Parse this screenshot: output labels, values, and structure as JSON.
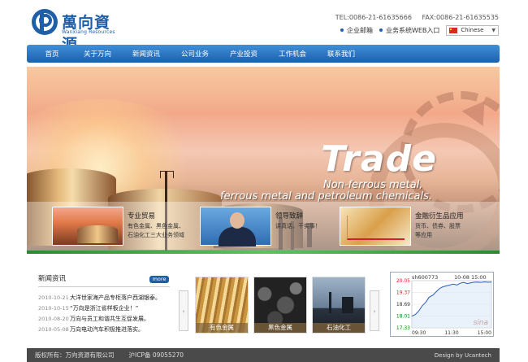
{
  "logo": {
    "cn": "萬向資源",
    "en": "Wanxiang Resources"
  },
  "contact": {
    "tel": "TEL:0086-21-61635666",
    "fax": "FAX:0086-21-61635535"
  },
  "quicklinks": [
    {
      "label": "企业邮箱"
    },
    {
      "label": "业务系统WEB入口"
    }
  ],
  "language": {
    "selected": "Chinese"
  },
  "nav": [
    {
      "label": "首页"
    },
    {
      "label": "关于万向"
    },
    {
      "label": "新闻资讯"
    },
    {
      "label": "公司业务"
    },
    {
      "label": "产业投资"
    },
    {
      "label": "工作机会"
    },
    {
      "label": "联系我们"
    }
  ],
  "banner": {
    "headline": "Trade",
    "line1": "Non-ferrous metal,",
    "line2": "ferrous metal and petroleum chemicals."
  },
  "features": [
    {
      "title": "专业贸易",
      "desc1": "有色金属、黑色金属、",
      "desc2": "石油化工三大业务领域"
    },
    {
      "title": "领导致辞",
      "desc1": "讲真话，干实事！",
      "desc2": ""
    },
    {
      "title": "金融衍生品应用",
      "desc1": "货币、债券、股票",
      "desc2": "等应用"
    }
  ],
  "news": {
    "heading": "新闻资讯",
    "more": "more",
    "items": [
      {
        "date": "2010-10-21",
        "title": "大洋世家海产品专柜落户西湖银泰。"
      },
      {
        "date": "2010-10-15",
        "title": "“万向是浙江省样板企业！”"
      },
      {
        "date": "2010-08-20",
        "title": "万向与员工和谐共生互促发展。"
      },
      {
        "date": "2010-05-08",
        "title": "万向电动汽车积极推进落实。"
      }
    ]
  },
  "products": [
    {
      "label": "有色金属"
    },
    {
      "label": "黑色金属"
    },
    {
      "label": "石油化工"
    }
  ],
  "carousel": {
    "prev": "‹",
    "next": "›"
  },
  "stock": {
    "code": "sh600773",
    "date": "10-08 15:00",
    "watermark": "sina",
    "y_labels": [
      "20.05",
      "19.37",
      "18.69",
      "18.01",
      "17.33"
    ],
    "x_labels": [
      "09:30",
      "11:30",
      "15:00"
    ],
    "ylim": [
      17.33,
      20.05
    ],
    "prices": [
      18.0,
      18.1,
      18.3,
      18.6,
      18.8,
      19.1,
      19.2,
      19.4,
      19.6,
      19.7,
      19.75,
      19.8,
      19.85,
      19.8,
      19.9,
      19.95,
      19.88,
      19.92,
      19.96,
      19.97,
      19.95,
      19.98,
      19.96,
      19.97
    ],
    "colors": {
      "line": "#2a5db0",
      "avg": "#d9a33a"
    }
  },
  "footer": {
    "copyright": "版权所有：万向资源有限公司",
    "icp": "沪ICP备 09055270",
    "design": "Design by Ucantech"
  }
}
